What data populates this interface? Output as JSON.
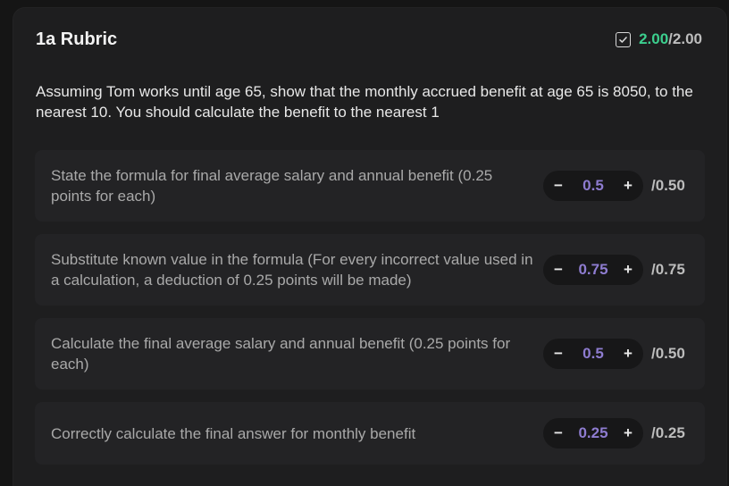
{
  "header": {
    "title": "1a Rubric",
    "score_obtained": "2.00",
    "score_sep": "/",
    "score_total": "2.00"
  },
  "question": "Assuming Tom works until age 65, show that the monthly accrued benefit at age 65 is 8050, to the nearest 10. You should calculate the benefit to the nearest 1",
  "criteria": [
    {
      "text": "State the formula for final average salary and annual benefit (0.25 points for each)",
      "value": "0.5",
      "max": "/0.50",
      "minus": "−",
      "plus": "+"
    },
    {
      "text": "Substitute known value in the formula (For every incorrect value used in a calculation, a deduction of 0.25 points will be made)",
      "value": "0.75",
      "max": "/0.75",
      "minus": "−",
      "plus": "+"
    },
    {
      "text": "Calculate the final average salary and annual benefit (0.25 points for each)",
      "value": "0.5",
      "max": "/0.50",
      "minus": "−",
      "plus": "+"
    },
    {
      "text": "Correctly calculate the final answer for monthly benefit",
      "value": "0.25",
      "max": "/0.25",
      "minus": "−",
      "plus": "+"
    }
  ],
  "colors": {
    "score_obtained": "#3ccf8e",
    "stepper_value": "#8e7cd0"
  }
}
